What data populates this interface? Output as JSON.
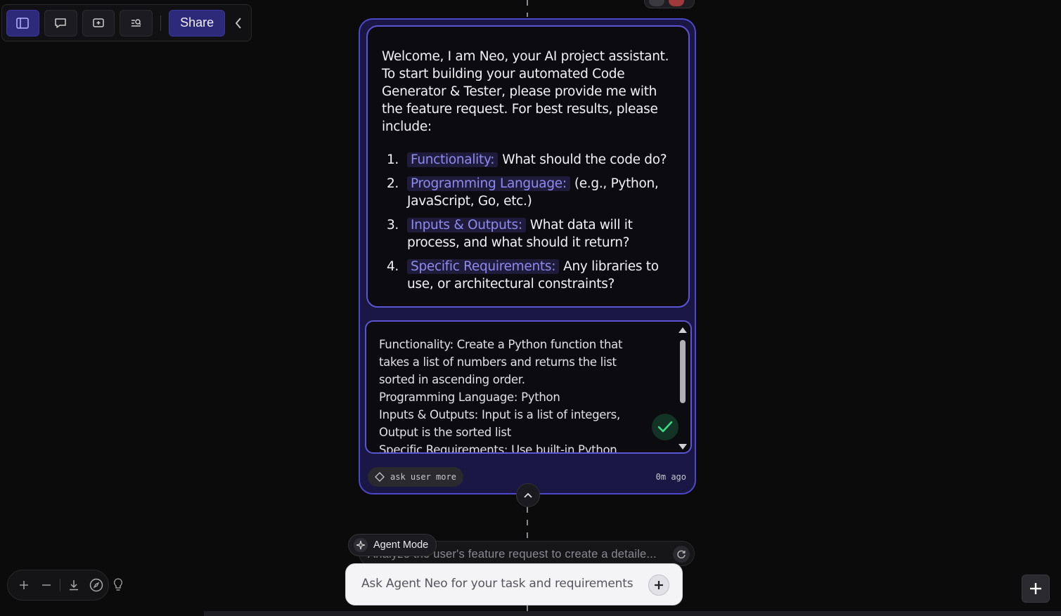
{
  "toolbar": {
    "buttons": [
      {
        "name": "sidebar-toggle-icon"
      },
      {
        "name": "comment-icon"
      },
      {
        "name": "add-frame-icon"
      },
      {
        "name": "search-icon"
      }
    ],
    "share_label": "Share"
  },
  "message": {
    "intro": "Welcome, I am Neo, your AI project assistant. To start building your automated Code Generator & Tester, please provide me with the feature request. For best results, please include:",
    "items": [
      {
        "num": "1.",
        "label": "Functionality:",
        "text": "What should the code do?"
      },
      {
        "num": "2.",
        "label": "Programming Language:",
        "text": "(e.g., Python, JavaScript, Go, etc.)"
      },
      {
        "num": "3.",
        "label": "Inputs & Outputs:",
        "text": "What data will it process, and what should it return?"
      },
      {
        "num": "4.",
        "label": "Specific Requirements:",
        "text": "Any libraries to use, or architectural constraints?"
      }
    ]
  },
  "reply": {
    "lines": [
      "Functionality: Create a Python function that takes a list of numbers and returns the list sorted in ascending order.",
      "Programming Language: Python",
      "Inputs & Outputs: Input is a list of integers, Output is the sorted list",
      "Specific Requirements: Use built-in Python"
    ]
  },
  "card_footer": {
    "tag_label": "ask user more",
    "time": "0m ago"
  },
  "task": {
    "text": "Analyze the user's feature request to create a detaile...",
    "agent_mode_label": "Agent Mode"
  },
  "input": {
    "placeholder": "Ask Agent Neo for your task and requirements"
  },
  "colors": {
    "accent": "#4d47c9",
    "highlight_text": "#8f8af0",
    "check": "#3ddc84"
  }
}
